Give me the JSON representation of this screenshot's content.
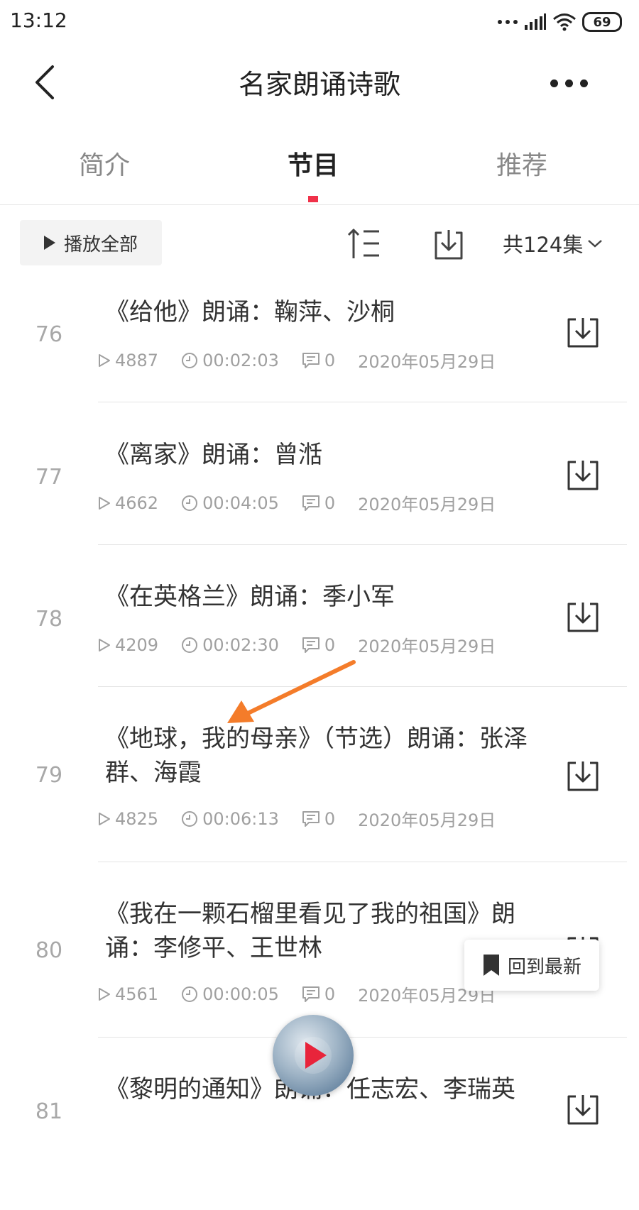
{
  "status": {
    "time": "13:12",
    "battery": "69"
  },
  "header": {
    "title": "名家朗诵诗歌"
  },
  "tabs": [
    {
      "label": "简介"
    },
    {
      "label": "节目"
    },
    {
      "label": "推荐"
    }
  ],
  "toolbar": {
    "play_all": "播放全部",
    "count": "共124集"
  },
  "episodes": [
    {
      "num": "76",
      "title": "《给他》朗诵：鞠萍、沙桐",
      "plays": "4887",
      "duration": "00:02:03",
      "comments": "0",
      "date": "2020年05月29日"
    },
    {
      "num": "77",
      "title": "《离家》朗诵：曾湉",
      "plays": "4662",
      "duration": "00:04:05",
      "comments": "0",
      "date": "2020年05月29日"
    },
    {
      "num": "78",
      "title": "《在英格兰》朗诵：季小军",
      "plays": "4209",
      "duration": "00:02:30",
      "comments": "0",
      "date": "2020年05月29日"
    },
    {
      "num": "79",
      "title": "《地球，我的母亲》（节选）朗诵：张泽群、海霞",
      "plays": "4825",
      "duration": "00:06:13",
      "comments": "0",
      "date": "2020年05月29日"
    },
    {
      "num": "80",
      "title": "《我在一颗石榴里看见了我的祖国》朗诵：李修平、王世林",
      "plays": "4561",
      "duration": "00:00:05",
      "comments": "0",
      "date": "2020年05月29日"
    },
    {
      "num": "81",
      "title": "《黎明的通知》朗诵：任志宏、李瑞英"
    }
  ],
  "floating": {
    "back_to_latest": "回到最新"
  }
}
